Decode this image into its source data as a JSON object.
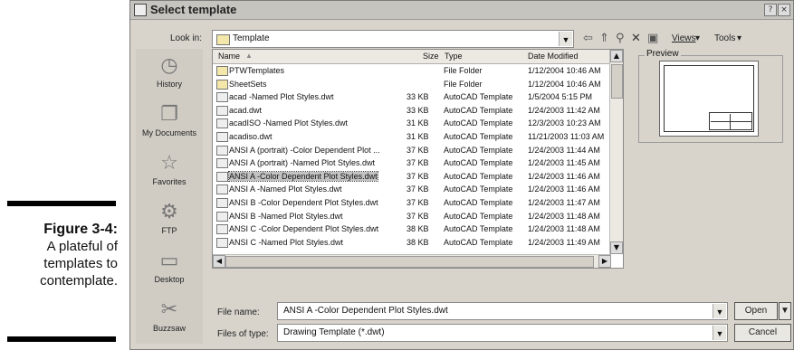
{
  "caption": {
    "figure": "Figure 3-4:",
    "line1": "A plateful of",
    "line2": "templates to",
    "line3": "contemplate."
  },
  "dialog": {
    "title": "Select template",
    "title_buttons": [
      "?",
      "×"
    ],
    "look_in_label": "Look in:",
    "look_in_value": "Template",
    "toolbar": {
      "views_label": "Views",
      "tools_label": "Tools"
    },
    "places": [
      {
        "label": "History",
        "icon": "history-icon"
      },
      {
        "label": "My Documents",
        "icon": "my-documents-icon"
      },
      {
        "label": "Favorites",
        "icon": "favorites-icon"
      },
      {
        "label": "FTP",
        "icon": "ftp-icon"
      },
      {
        "label": "Desktop",
        "icon": "desktop-icon"
      },
      {
        "label": "Buzzsaw",
        "icon": "buzzsaw-icon"
      }
    ],
    "columns": [
      "Name",
      "Size",
      "Type",
      "Date Modified"
    ],
    "files": [
      {
        "name": "PTWTemplates",
        "size": "",
        "type": "File Folder",
        "date": "1/12/2004 10:46 AM",
        "folder": true
      },
      {
        "name": "SheetSets",
        "size": "",
        "type": "File Folder",
        "date": "1/12/2004 10:46 AM",
        "folder": true
      },
      {
        "name": "acad -Named Plot Styles.dwt",
        "size": "33 KB",
        "type": "AutoCAD Template",
        "date": "1/5/2004 5:15 PM"
      },
      {
        "name": "acad.dwt",
        "size": "33 KB",
        "type": "AutoCAD Template",
        "date": "1/24/2003 11:42 AM"
      },
      {
        "name": "acadISO -Named Plot Styles.dwt",
        "size": "31 KB",
        "type": "AutoCAD Template",
        "date": "12/3/2003 10:23 AM"
      },
      {
        "name": "acadiso.dwt",
        "size": "31 KB",
        "type": "AutoCAD Template",
        "date": "11/21/2003 11:03 AM"
      },
      {
        "name": "ANSI A (portrait) -Color Dependent Plot ...",
        "size": "37 KB",
        "type": "AutoCAD Template",
        "date": "1/24/2003 11:44 AM"
      },
      {
        "name": "ANSI A (portrait) -Named Plot Styles.dwt",
        "size": "37 KB",
        "type": "AutoCAD Template",
        "date": "1/24/2003 11:45 AM"
      },
      {
        "name": "ANSI A -Color Dependent Plot Styles.dwt",
        "size": "37 KB",
        "type": "AutoCAD Template",
        "date": "1/24/2003 11:46 AM",
        "selected": true
      },
      {
        "name": "ANSI A -Named Plot Styles.dwt",
        "size": "37 KB",
        "type": "AutoCAD Template",
        "date": "1/24/2003 11:46 AM"
      },
      {
        "name": "ANSI B -Color Dependent Plot Styles.dwt",
        "size": "37 KB",
        "type": "AutoCAD Template",
        "date": "1/24/2003 11:47 AM"
      },
      {
        "name": "ANSI B -Named Plot Styles.dwt",
        "size": "37 KB",
        "type": "AutoCAD Template",
        "date": "1/24/2003 11:48 AM"
      },
      {
        "name": "ANSI C -Color Dependent Plot Styles.dwt",
        "size": "38 KB",
        "type": "AutoCAD Template",
        "date": "1/24/2003 11:48 AM"
      },
      {
        "name": "ANSI C -Named Plot Styles.dwt",
        "size": "38 KB",
        "type": "AutoCAD Template",
        "date": "1/24/2003 11:49 AM"
      }
    ],
    "preview_label": "Preview",
    "file_name_label": "File name:",
    "file_name_value": "ANSI A -Color Dependent Plot Styles.dwt",
    "files_of_type_label": "Files of type:",
    "files_of_type_value": "Drawing Template (*.dwt)",
    "open_label": "Open",
    "cancel_label": "Cancel"
  }
}
